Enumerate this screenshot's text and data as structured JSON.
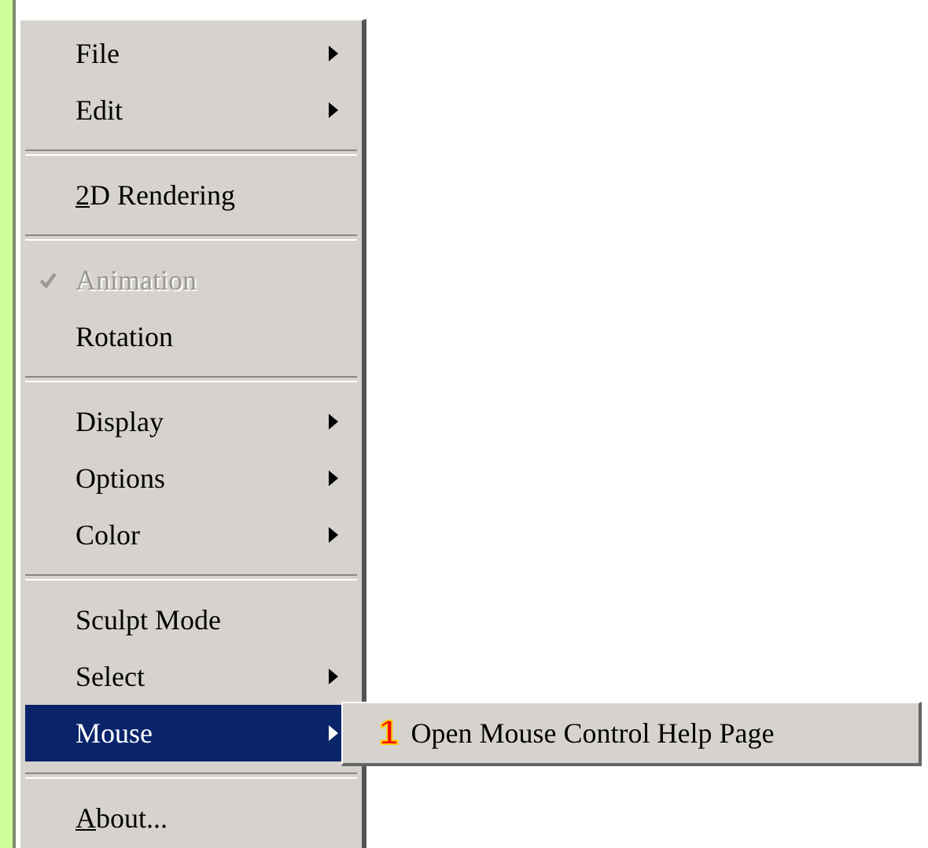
{
  "menu": {
    "items": [
      {
        "kind": "item",
        "label": "File",
        "submenu": true,
        "checked": false,
        "disabled": false,
        "selected": false,
        "mnemonic": false
      },
      {
        "kind": "item",
        "label": "Edit",
        "submenu": true,
        "checked": false,
        "disabled": false,
        "selected": false,
        "mnemonic": false
      },
      {
        "kind": "separator"
      },
      {
        "kind": "item",
        "label": "2D Rendering",
        "submenu": false,
        "checked": false,
        "disabled": false,
        "selected": false,
        "mnemonic": true
      },
      {
        "kind": "separator"
      },
      {
        "kind": "item",
        "label": "Animation",
        "submenu": false,
        "checked": true,
        "disabled": true,
        "selected": false,
        "mnemonic": false
      },
      {
        "kind": "item",
        "label": "Rotation",
        "submenu": false,
        "checked": false,
        "disabled": false,
        "selected": false,
        "mnemonic": false
      },
      {
        "kind": "separator"
      },
      {
        "kind": "item",
        "label": "Display",
        "submenu": true,
        "checked": false,
        "disabled": false,
        "selected": false,
        "mnemonic": false
      },
      {
        "kind": "item",
        "label": "Options",
        "submenu": true,
        "checked": false,
        "disabled": false,
        "selected": false,
        "mnemonic": false
      },
      {
        "kind": "item",
        "label": "Color",
        "submenu": true,
        "checked": false,
        "disabled": false,
        "selected": false,
        "mnemonic": false
      },
      {
        "kind": "separator"
      },
      {
        "kind": "item",
        "label": "Sculpt Mode",
        "submenu": false,
        "checked": false,
        "disabled": false,
        "selected": false,
        "mnemonic": false
      },
      {
        "kind": "item",
        "label": "Select",
        "submenu": true,
        "checked": false,
        "disabled": false,
        "selected": false,
        "mnemonic": false
      },
      {
        "kind": "item",
        "label": "Mouse",
        "submenu": true,
        "checked": false,
        "disabled": false,
        "selected": true,
        "mnemonic": false
      },
      {
        "kind": "separator"
      },
      {
        "kind": "item",
        "label": "About...",
        "submenu": false,
        "checked": false,
        "disabled": false,
        "selected": false,
        "mnemonic": true
      }
    ]
  },
  "submenu": {
    "items": [
      {
        "badge": "1",
        "label": "Open Mouse Control Help Page"
      }
    ]
  }
}
